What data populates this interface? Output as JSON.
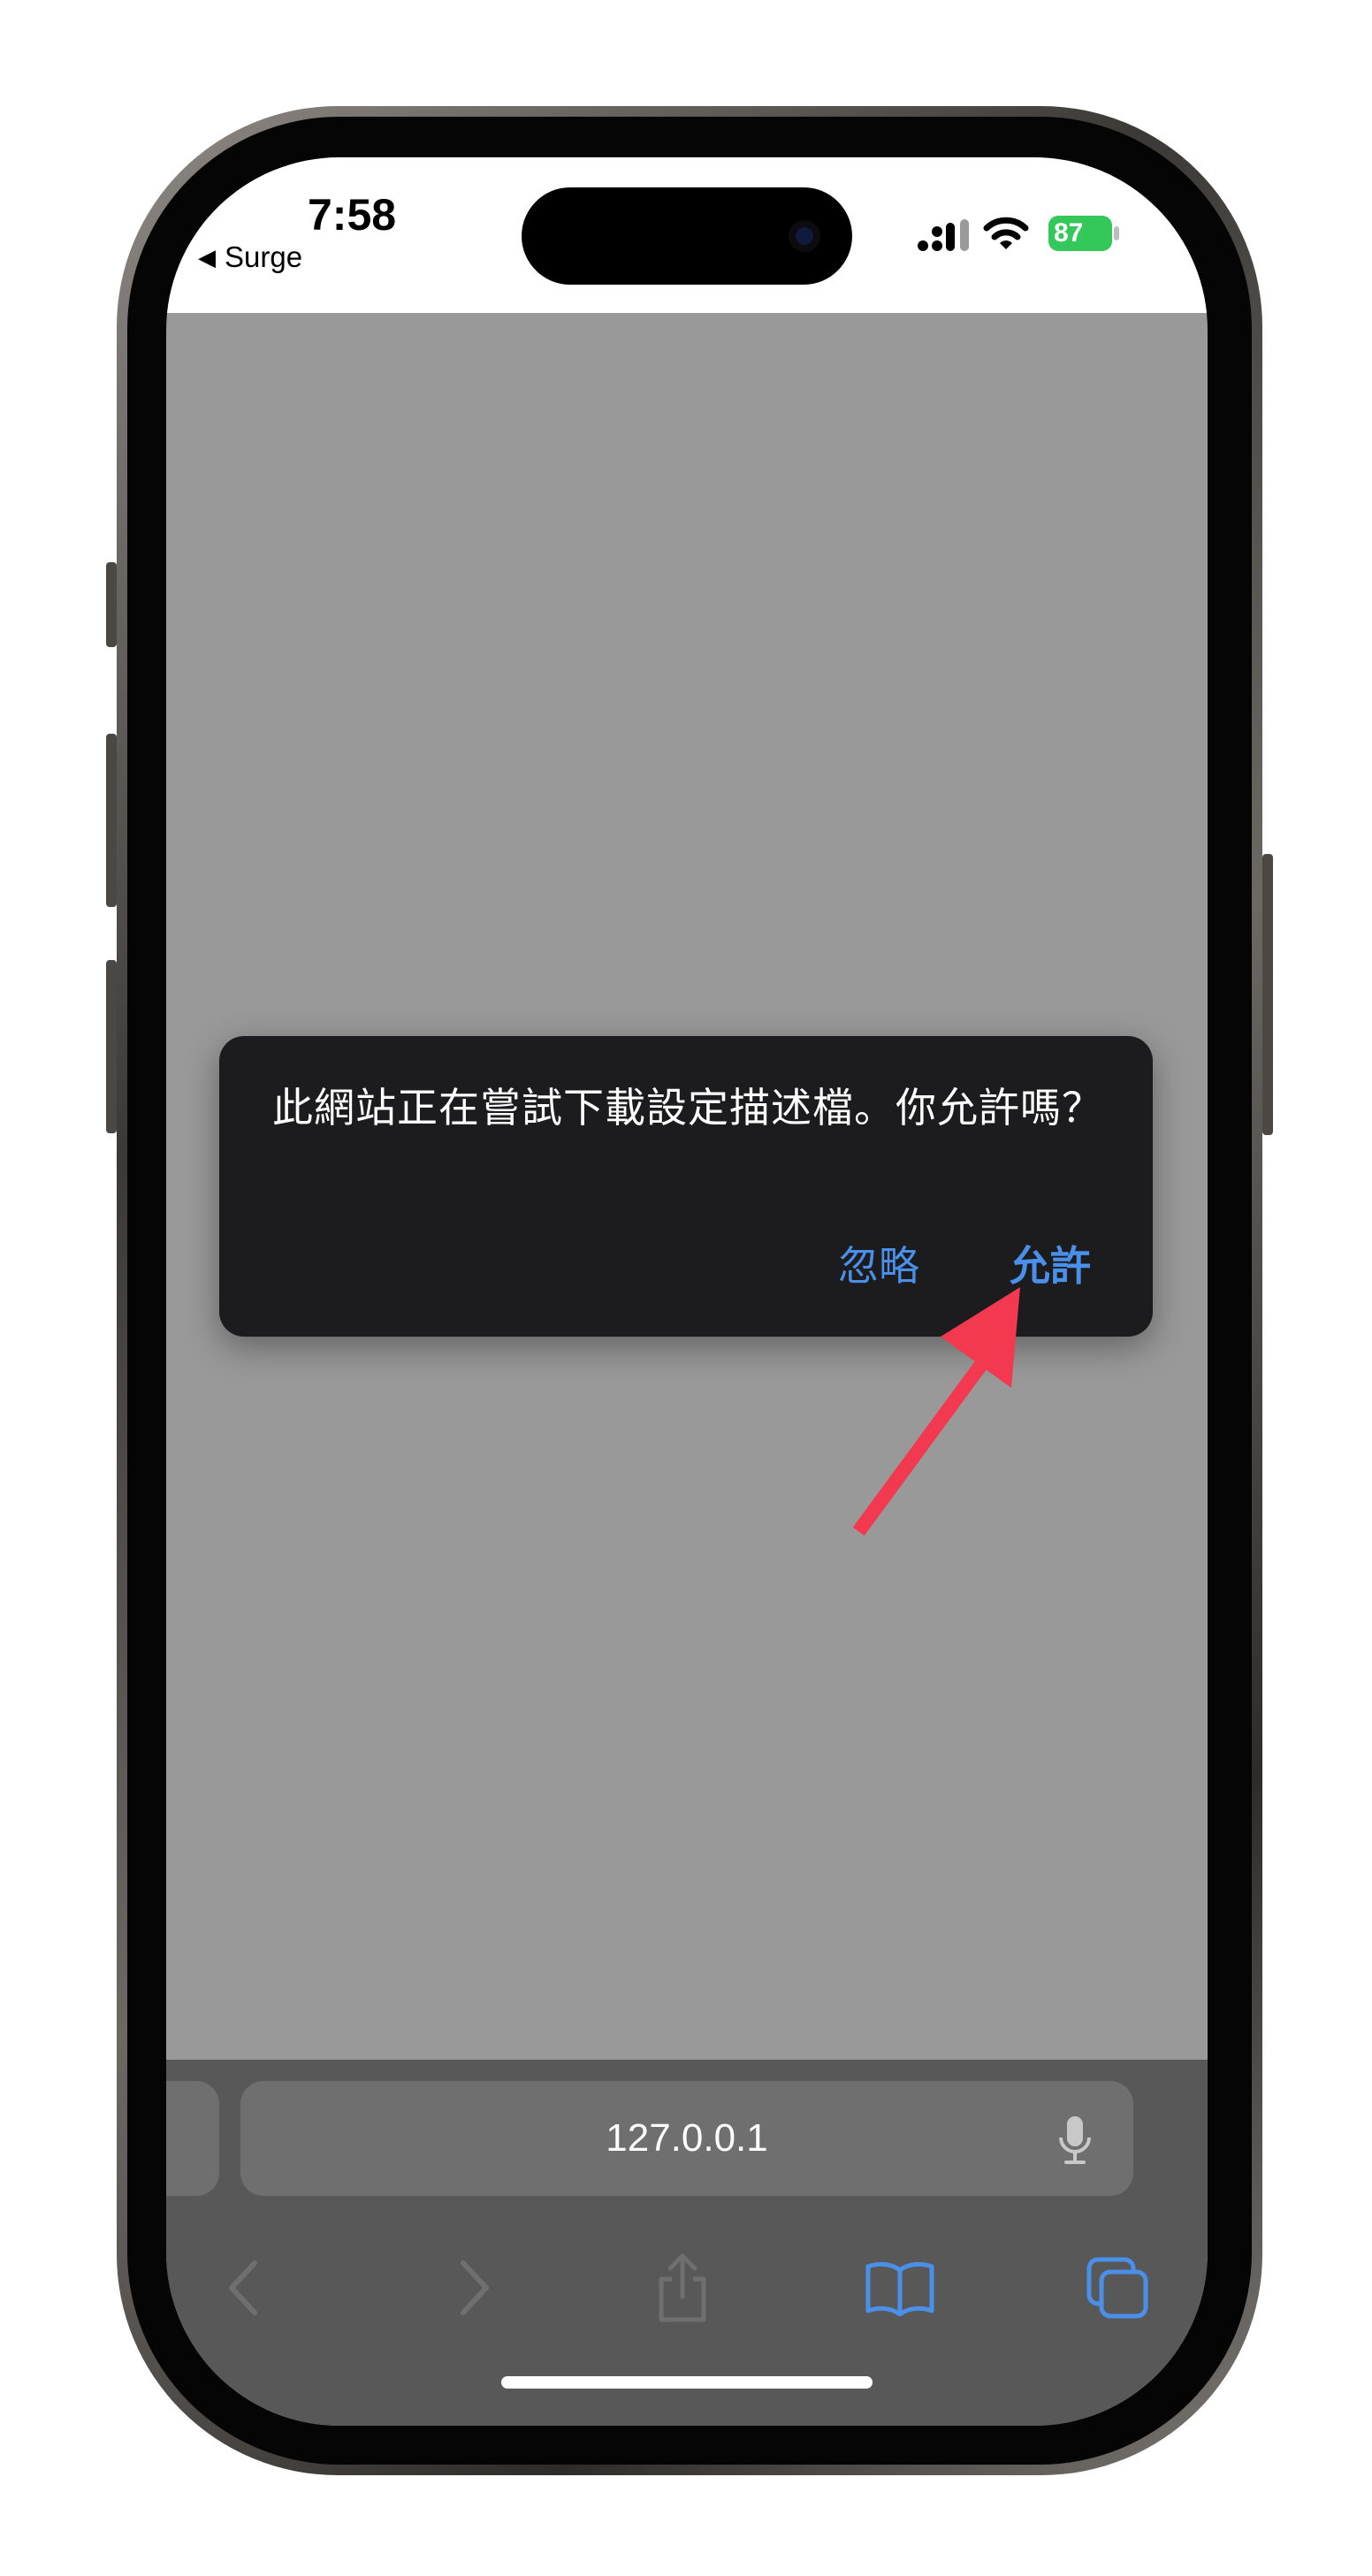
{
  "status_bar": {
    "time": "7:58",
    "back_app": "Surge",
    "battery": "87"
  },
  "dialog": {
    "message": "此網站正在嘗試下載設定描述檔。你允許嗎？",
    "ignore_label": "忽略",
    "allow_label": "允許"
  },
  "toolbar": {
    "url": "127.0.0.1"
  },
  "colors": {
    "accent": "#4a90e8",
    "annotation_arrow": "#f2394f",
    "battery": "#34c759"
  },
  "icons": [
    "back-arrow-icon",
    "forward-arrow-icon",
    "share-icon",
    "bookmarks-icon",
    "tabs-icon",
    "microphone-icon",
    "signal-icon",
    "wifi-icon",
    "battery-icon"
  ]
}
